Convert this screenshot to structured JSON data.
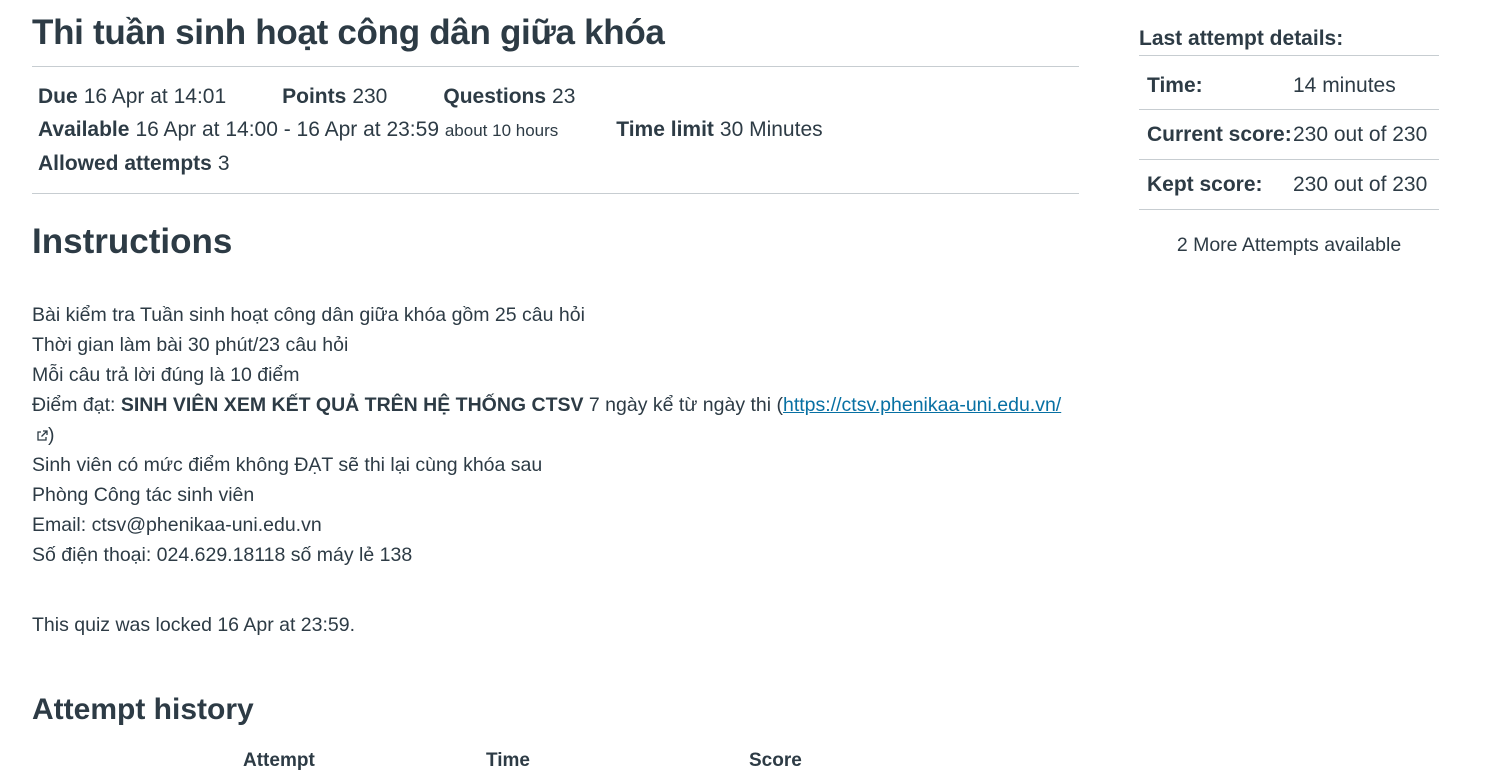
{
  "quiz": {
    "title": "Thi tuần sinh hoạt công dân giữa khóa",
    "due_label": "Due",
    "due_value": "16 Apr at 14:01",
    "points_label": "Points",
    "points_value": "230",
    "questions_label": "Questions",
    "questions_value": "23",
    "available_label": "Available",
    "available_value": "16 Apr at 14:00 - 16 Apr at 23:59",
    "available_note": "about 10 hours",
    "time_limit_label": "Time limit",
    "time_limit_value": "30 Minutes",
    "attempts_label": "Allowed attempts",
    "attempts_value": "3"
  },
  "instructions": {
    "heading": "Instructions",
    "line1": "Bài kiểm tra Tuần sinh hoạt công dân giữa khóa gồm 25 câu hỏi",
    "line2": "Thời gian làm bài 30 phút/23 câu hỏi",
    "line3": "Mỗi câu trả lời đúng là 10 điểm",
    "line4_prefix": "Điểm đạt: ",
    "line4_bold": "SINH VIÊN XEM KẾT QUẢ TRÊN HỆ THỐNG CTSV",
    "line4_middle": " 7 ngày kể từ ngày thi (",
    "line4_link": "https://ctsv.phenikaa-uni.edu.vn/",
    "line4_suffix": ")",
    "line5": "Sinh viên có mức điểm không ĐẠT sẽ thi lại cùng khóa sau",
    "line6": "Phòng Công tác sinh viên",
    "line7": "Email: ctsv@phenikaa-uni.edu.vn",
    "line8": "Số điện thoại: 024.629.18118 số máy lẻ 138"
  },
  "locked_message": "This quiz was locked 16 Apr at 23:59.",
  "history": {
    "heading": "Attempt history",
    "col_attempt": "Attempt",
    "col_time": "Time",
    "col_score": "Score"
  },
  "sidebar": {
    "title": "Last attempt details:",
    "time_label": "Time:",
    "time_value": "14 minutes",
    "current_label": "Current score:",
    "current_value": "230 out of 230",
    "kept_label": "Kept score:",
    "kept_value": "230 out of 230",
    "more_attempts": "2 More Attempts available"
  },
  "colors": {
    "text": "#2d3b45",
    "link": "#0770a3",
    "divider": "#c7cdd1"
  }
}
